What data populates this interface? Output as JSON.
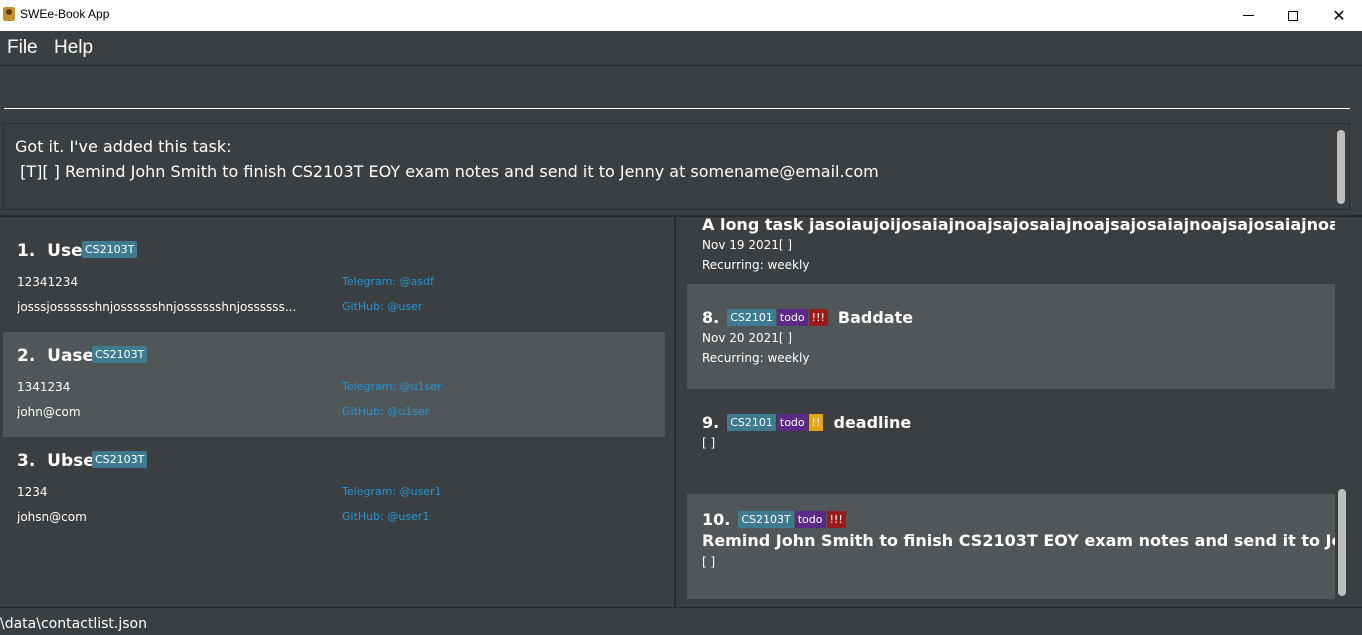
{
  "window": {
    "title": "SWEe-Book App",
    "minimize_icon": "minimize-icon",
    "maximize_icon": "maximize-icon",
    "close_glyph": "✕"
  },
  "menu": {
    "file": "File",
    "help": "Help"
  },
  "command": {
    "value": "",
    "placeholder": ""
  },
  "result": {
    "text": "Got it. I've added this task:\n [T][ ] Remind John Smith to finish CS2103T EOY exam notes and send it to Jenny at somename@email.com"
  },
  "persons": [
    {
      "index": "1.",
      "name": "User",
      "tag": "CS2103T",
      "phone": "12341234",
      "email": "josssjosssssshnjosssssshnjosssssshnjossssss...",
      "telegram": "Telegram: @asdf",
      "github": "GitHub: @user"
    },
    {
      "index": "2.",
      "name": "Uaser",
      "tag": "CS2103T",
      "phone": "1341234",
      "email": "john@com",
      "telegram": "Telegram: @u1ser",
      "github": "GitHub: @u1ser"
    },
    {
      "index": "3.",
      "name": "Ubser",
      "tag": "CS2103T",
      "phone": "1234",
      "email": "johsn@com",
      "telegram": "Telegram: @user1",
      "github": "GitHub: @user1"
    }
  ],
  "tasks": [
    {
      "title": "A long task jasoiaujoijosaiajnoajsajosaiajnoajsajosaiajnoajsajosaiajnoajsajosaiajno",
      "date": "Nov 19 2021[ ]",
      "recurring": "Recurring: weekly"
    },
    {
      "index": "8.",
      "module": "CS2101",
      "type": "todo",
      "priority": "!!!",
      "title": "Baddate",
      "date": "Nov 20 2021[ ]",
      "recurring": "Recurring: weekly"
    },
    {
      "index": "9.",
      "module": "CS2101",
      "type": "todo",
      "priority": "!!",
      "title": "deadline",
      "date": "[ ]"
    },
    {
      "index": "10.",
      "module": "CS2103T",
      "type": "todo",
      "priority": "!!!",
      "title": "Remind John Smith to finish CS2103T EOY exam notes and send it to Jenny at somename@email.com",
      "date": "[ ]"
    }
  ],
  "status": {
    "path": "\\data\\contactlist.json"
  },
  "colors": {
    "background": "#3c3f41",
    "selected": "#515658",
    "tag": "#3e7b91",
    "todo": "#5b2a86",
    "priority_high": "#9b1b1b",
    "priority_medium": "#e8a215",
    "link": "#2196d9"
  }
}
